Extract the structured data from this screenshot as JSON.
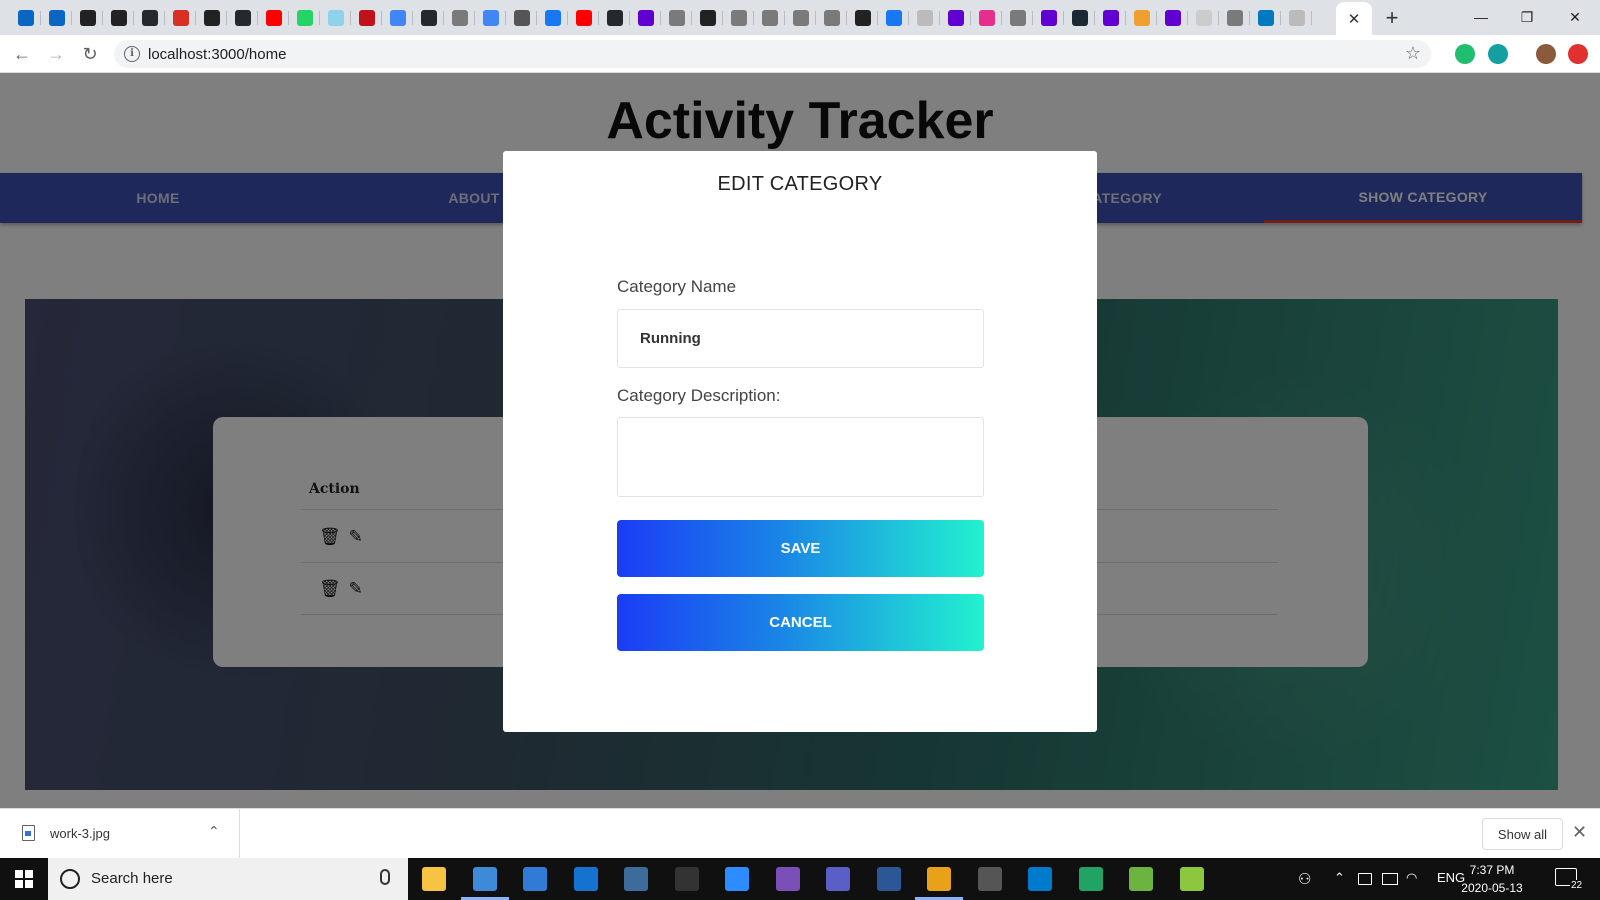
{
  "browser": {
    "favicon_colors": [
      "#0a66c2",
      "#0a66c2",
      "#222222",
      "#222222",
      "#24292e",
      "#d93025",
      "#222222",
      "#24292e",
      "#ff0000",
      "#25d366",
      "#8fd3ea",
      "#c0121c",
      "#4285f4",
      "#24292e",
      "#7a7a7a",
      "#4285f4",
      "#555555",
      "#1877f2",
      "#ff0000",
      "#24292e",
      "#6001d2",
      "#7a7a7a",
      "#222222",
      "#7a7a7a",
      "#7a7a7a",
      "#7a7a7a",
      "#7a7a7a",
      "#222222",
      "#1877f2",
      "#bbbbbb",
      "#6001d2",
      "#e62e8c",
      "#7a7a7a",
      "#6001d2",
      "#1c2833",
      "#6001d2",
      "#f0a030",
      "#6001d2",
      "#cccccc",
      "#7a7a7a",
      "#0079bf",
      "#bbbbbb"
    ],
    "active_tab_close": "✕",
    "new_tab": "+",
    "window_controls": {
      "minimize": "—",
      "maximize": "❐",
      "close": "✕"
    },
    "url": "localhost:3000/home",
    "info_icon": "i",
    "bookmark_icon": "☆",
    "extension_colors": [
      "#1fbf6f",
      "#14a0a0",
      "#8a5a3a",
      "#e03030"
    ]
  },
  "site": {
    "title": "Activity Tracker",
    "nav": [
      "HOME",
      "ABOUT",
      "ATEGORY",
      "SHOW CATEGORY"
    ],
    "active_nav_index": 3,
    "table": {
      "header_action": "Action",
      "row_icons": [
        "🗑",
        "✎"
      ]
    }
  },
  "modal": {
    "title": "EDIT CATEGORY",
    "name_label": "Category Name",
    "name_value": "Running",
    "description_label": "Category Description:",
    "description_value": "",
    "save_label": "SAVE",
    "cancel_label": "CANCEL"
  },
  "downloads": {
    "file_name": "work-3.jpg",
    "show_all_label": "Show all",
    "chevron": "⌃",
    "close": "✕"
  },
  "taskbar": {
    "search_placeholder": "Search here",
    "icon_colors": [
      "#f6c343",
      "#3c8ad8",
      "#2f7bd6",
      "#1572d0",
      "#3d6b9c",
      "#333333",
      "#2d8cff",
      "#7b4fb8",
      "#5a5fc7",
      "#2b5797",
      "#e8a21a",
      "#555555",
      "#007acc",
      "#21a366",
      "#6db33f",
      "#8dc63f"
    ],
    "tray_language": "ENG",
    "time": "7:37 PM",
    "date": "2020-05-13",
    "notification_count": "22"
  }
}
